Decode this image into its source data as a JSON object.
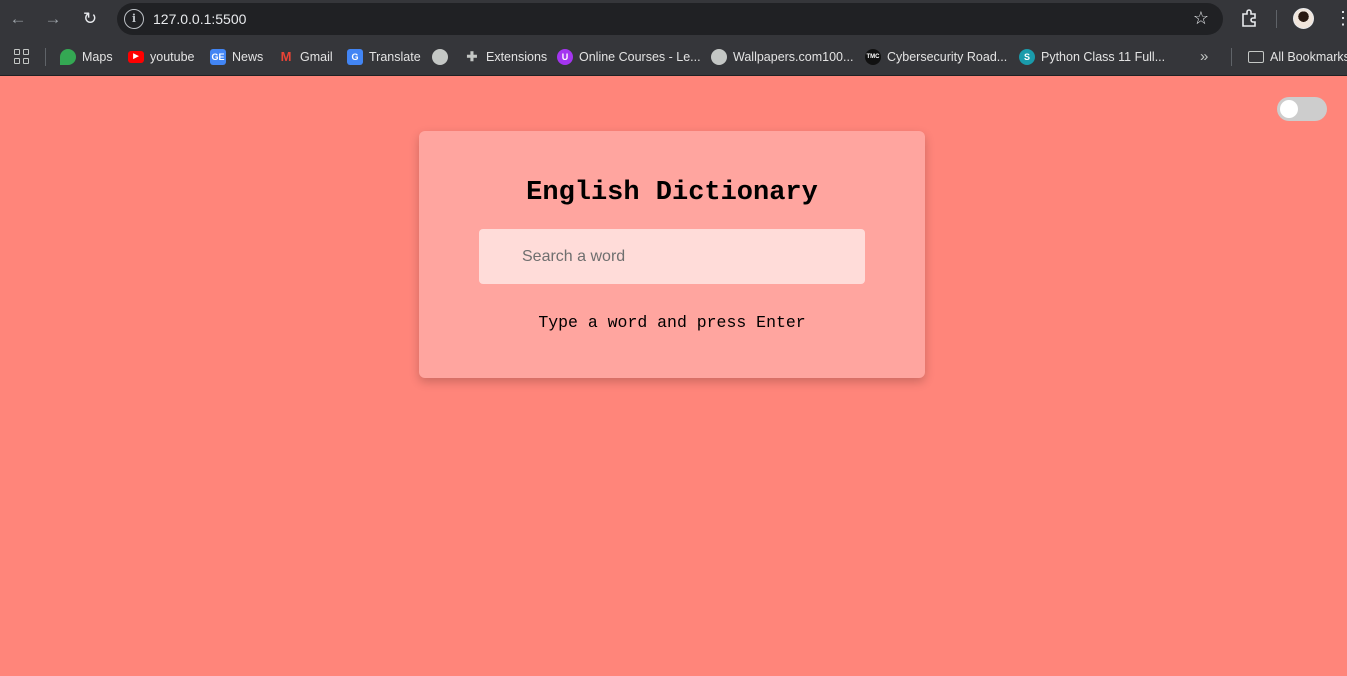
{
  "browser": {
    "url": "127.0.0.1:5500",
    "bookmarks": [
      {
        "label": "Maps",
        "icon": "maps-icon",
        "color": "#34a853"
      },
      {
        "label": "youtube",
        "icon": "youtube-icon",
        "color": "#ff0000"
      },
      {
        "label": "News",
        "icon": "news-icon",
        "color": "#4285f4"
      },
      {
        "label": "Gmail",
        "icon": "gmail-icon",
        "color": "#ea4335"
      },
      {
        "label": "Translate",
        "icon": "translate-icon",
        "color": "#4285f4"
      },
      {
        "label": "",
        "icon": "globe-icon",
        "color": "#c4c7c5"
      },
      {
        "label": "Extensions",
        "icon": "puzzle-icon",
        "color": "#c4c7c5"
      },
      {
        "label": "Online Courses - Le...",
        "icon": "udemy-icon",
        "color": "#a435f0"
      },
      {
        "label": "Wallpapers.com100...",
        "icon": "globe-icon",
        "color": "#c4c7c5"
      },
      {
        "label": "Cybersecurity Road...",
        "icon": "tmc-icon",
        "color": "#111111"
      },
      {
        "label": "Python Class 11 Full...",
        "icon": "s-icon",
        "color": "#1a9bab"
      }
    ],
    "all_bookmarks_label": "All Bookmarks"
  },
  "page": {
    "background_color": "#ff857a",
    "card_color": "#ffa59f",
    "title": "English Dictionary",
    "search_placeholder": "Search a word",
    "info_text": "Type a word and press Enter",
    "theme_toggle_on": false
  }
}
